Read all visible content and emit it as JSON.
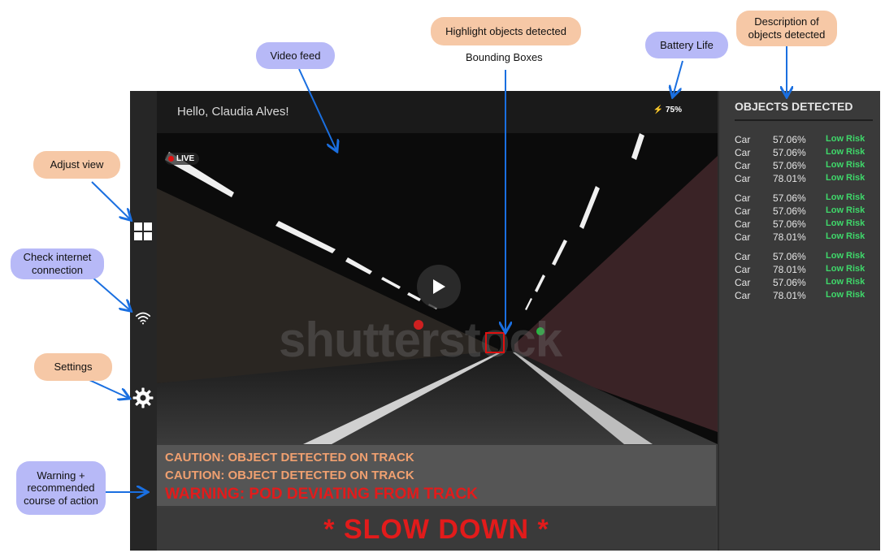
{
  "annotations": {
    "video_feed": "Video feed",
    "highlight_objects": "Highlight objects detected",
    "bounding_boxes": "Bounding Boxes",
    "battery_life": "Battery Life",
    "description_objects": "Description of objects detected",
    "adjust_view": "Adjust view",
    "check_internet": "Check internet connection",
    "settings": "Settings",
    "warning_action": "Warning + recommended course of action"
  },
  "video": {
    "greeting": "Hello, Claudia Alves!",
    "battery": "⚡ 75%",
    "live": "LIVE",
    "watermark": "shutterstock"
  },
  "warnings": {
    "lines": [
      "CAUTION: OBJECT DETECTED ON TRACK",
      "CAUTION: OBJECT DETECTED ON TRACK",
      "WARNING: POD DEVIATING FROM TRACK"
    ],
    "slow_down": "* SLOW DOWN *"
  },
  "objects_panel": {
    "title": "OBJECTS DETECTED",
    "rows": [
      {
        "name": "Car",
        "pct": "57.06%",
        "risk": "Low Risk"
      },
      {
        "name": "Car",
        "pct": "57.06%",
        "risk": "Low Risk"
      },
      {
        "name": "Car",
        "pct": "57.06%",
        "risk": "Low Risk"
      },
      {
        "name": "Car",
        "pct": "78.01%",
        "risk": "Low Risk"
      },
      {
        "name": "Car",
        "pct": "57.06%",
        "risk": "Low Risk"
      },
      {
        "name": "Car",
        "pct": "57.06%",
        "risk": "Low Risk"
      },
      {
        "name": "Car",
        "pct": "57.06%",
        "risk": "Low Risk"
      },
      {
        "name": "Car",
        "pct": "78.01%",
        "risk": "Low Risk"
      },
      {
        "name": "Car",
        "pct": "57.06%",
        "risk": "Low Risk"
      },
      {
        "name": "Car",
        "pct": "78.01%",
        "risk": "Low Risk"
      },
      {
        "name": "Car",
        "pct": "57.06%",
        "risk": "Low Risk"
      },
      {
        "name": "Car",
        "pct": "78.01%",
        "risk": "Low Risk"
      }
    ]
  },
  "icons": {
    "adjust_view": "grid-icon",
    "internet": "wifi-icon",
    "settings": "gear-icon",
    "play": "play-icon"
  },
  "colors": {
    "warning_orange": "#f0a070",
    "warning_red": "#e21b1b",
    "low_risk_green": "#3fd86a",
    "annotation_orange": "#f6c8a6",
    "annotation_purple": "#b7b9f7",
    "arrow_blue": "#1a6fe0"
  }
}
